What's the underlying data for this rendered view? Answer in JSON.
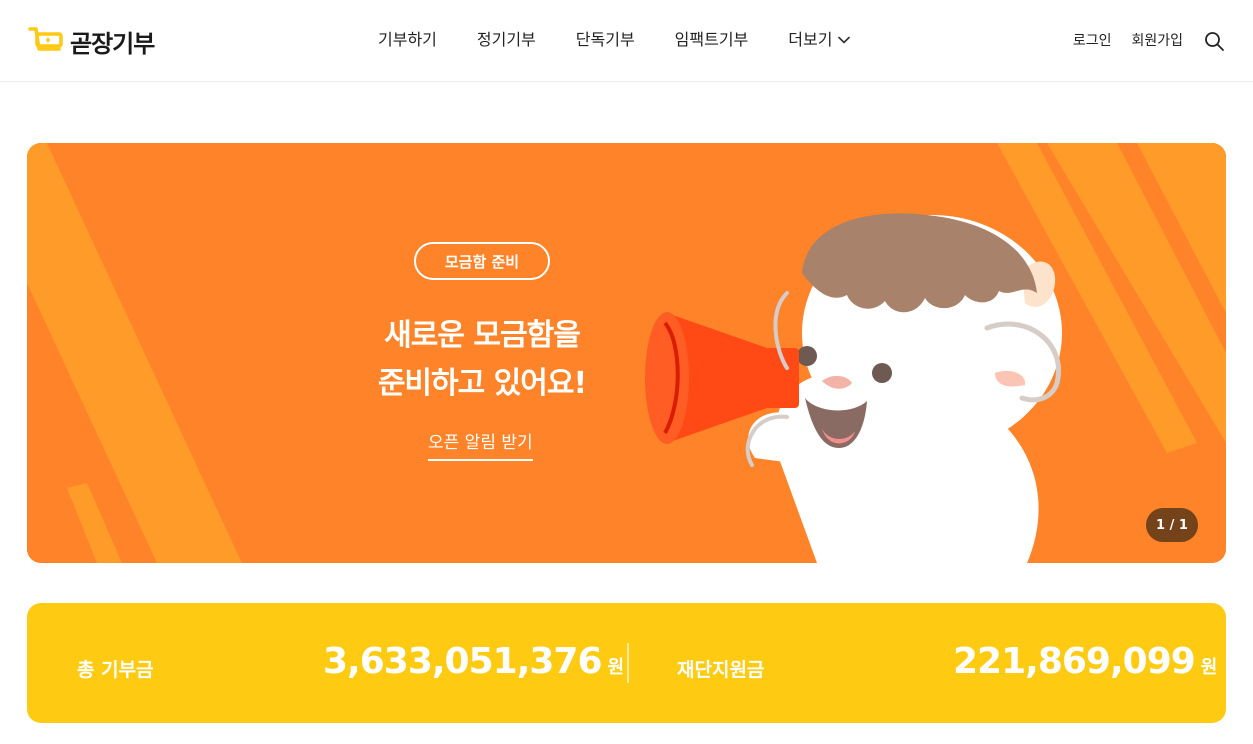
{
  "brand": {
    "name": "곧장기부",
    "color": "#fec914"
  },
  "nav": {
    "items": [
      "기부하기",
      "정기기부",
      "단독기부",
      "임팩트기부"
    ],
    "more_label": "더보기"
  },
  "util": {
    "login": "로그인",
    "signup": "회원가입",
    "search_icon": "search-icon"
  },
  "banner": {
    "chip": "모금함 준비",
    "headline_line1": "새로운 모금함을",
    "headline_line2": "준비하고 있어요!",
    "cta": "오픈 알림 받기",
    "pager": "1 / 1",
    "bg_color": "#fe8329"
  },
  "stats": {
    "total_label": "총 기부금",
    "total_value": "3,633,051,376",
    "total_unit": "원",
    "foundation_label": "재단지원금",
    "foundation_value": "221,869,099",
    "foundation_unit": "원",
    "bg_color": "#fecb12"
  }
}
